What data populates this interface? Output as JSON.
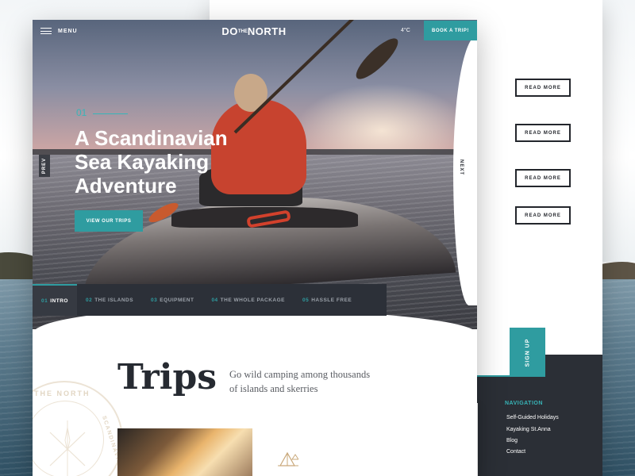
{
  "brand": {
    "logo_do": "DO",
    "logo_the": "THE",
    "logo_north": "NORTH"
  },
  "header": {
    "menu_label": "MENU",
    "temperature": "4°C",
    "book_label": "BOOK A TRIP!"
  },
  "hero": {
    "slide_number": "01",
    "title": "A Scandinavian Sea Kayaking Adventure",
    "cta_label": "VIEW OUR TRIPS",
    "prev_label": "PREV",
    "next_label": "NEXT",
    "tabs": [
      {
        "num": "01",
        "label": "INTRO",
        "active": true
      },
      {
        "num": "02",
        "label": "THE ISLANDS",
        "active": false
      },
      {
        "num": "03",
        "label": "EQUIPMENT",
        "active": false
      },
      {
        "num": "04",
        "label": "THE WHOLE PACKAGE",
        "active": false
      },
      {
        "num": "05",
        "label": "HASSLE FREE",
        "active": false
      }
    ]
  },
  "trips": {
    "title": "Trips",
    "description": "Go wild camping among thousands of islands and skerries",
    "stamp_text": "THE NORTH",
    "stamp_text_side": "SCANDINAVIA"
  },
  "back_page": {
    "read_more_label": "READ MORE",
    "signup_label": "SIGN UP",
    "nav_title": "NAVIGATION",
    "nav_links": [
      "Self-Guided Holidays",
      "Kayaking St.Anna",
      "Blog",
      "Contact"
    ]
  },
  "colors": {
    "accent": "#2f9ca0",
    "dark": "#2c3038",
    "text": "#262a31"
  }
}
